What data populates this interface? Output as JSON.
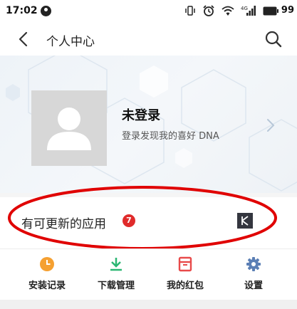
{
  "statusbar": {
    "time": "17:02",
    "battery": "99",
    "icons": [
      "notification-icon",
      "vibrate-icon",
      "alarm-icon",
      "wifi-icon",
      "signal-icon",
      "battery-icon"
    ]
  },
  "header": {
    "title": "个人中心",
    "back_icon": "chevron-left-icon",
    "search_icon": "search-icon"
  },
  "profile": {
    "name": "未登录",
    "subtitle": "登录发现我的喜好 DNA",
    "avatar_icon": "user-silhouette-icon",
    "chevron_icon": "chevron-right-icon"
  },
  "updates": {
    "label": "有可更新的应用",
    "count": "7",
    "app_icon": "k-app-icon"
  },
  "shortcuts": [
    {
      "label": "安装记录",
      "icon": "clock-icon",
      "color": "#f5a031"
    },
    {
      "label": "下载管理",
      "icon": "download-icon",
      "color": "#2bb673"
    },
    {
      "label": "我的红包",
      "icon": "red-envelope-icon",
      "color": "#e84a4a"
    },
    {
      "label": "设置",
      "icon": "gear-icon",
      "color": "#5b7fb5"
    }
  ],
  "colors": {
    "badge": "#e02b2b",
    "annotation_circle": "#e00000"
  }
}
